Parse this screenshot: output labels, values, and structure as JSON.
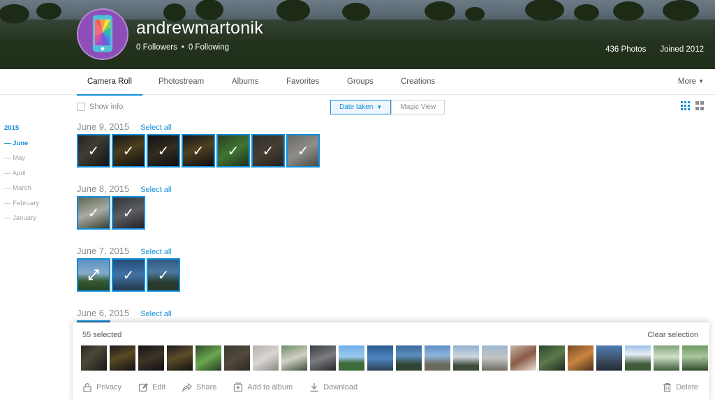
{
  "profile": {
    "username": "andrewmartonik",
    "followers": "0 Followers",
    "following": "0 Following",
    "separator": "•",
    "photos": "436 Photos",
    "joined": "Joined 2012"
  },
  "nav": {
    "tabs": [
      {
        "label": "Camera Roll",
        "active": true
      },
      {
        "label": "Photostream"
      },
      {
        "label": "Albums"
      },
      {
        "label": "Favorites"
      },
      {
        "label": "Groups"
      },
      {
        "label": "Creations"
      }
    ],
    "more": "More"
  },
  "toolbar": {
    "show_info": "Show info",
    "date_taken": "Date taken",
    "magic_view": "Magic View"
  },
  "sidebar": {
    "year": "2015",
    "months": [
      "June",
      "May",
      "April",
      "March",
      "February",
      "January"
    ],
    "active_month": "June",
    "dash": "—"
  },
  "groups": [
    {
      "date": "June 9, 2015",
      "select_all": "Select all",
      "count": 7
    },
    {
      "date": "June 8, 2015",
      "select_all": "Select all",
      "count": 2
    },
    {
      "date": "June 7, 2015",
      "select_all": "Select all",
      "count": 3
    },
    {
      "date": "June 6, 2015",
      "select_all": "Select all",
      "count": 1
    }
  ],
  "selection": {
    "count_label": "55 selected",
    "clear": "Clear selection",
    "actions": [
      "Privacy",
      "Edit",
      "Share",
      "Add to album",
      "Download"
    ],
    "delete": "Delete"
  },
  "colors": {
    "accent": "#128fdc",
    "avatar": "#8d4eb9"
  }
}
